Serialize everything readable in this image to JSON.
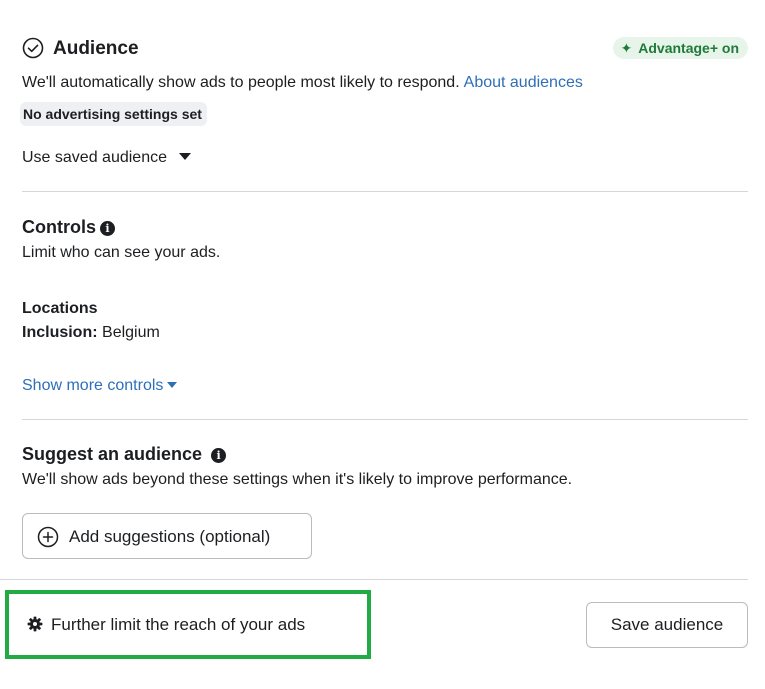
{
  "audience": {
    "title": "Audience",
    "advantage_badge": "Advantage+ on",
    "description": "We'll automatically show ads to people most likely to respond.",
    "about_link": "About audiences",
    "settings_tag": "No advertising settings set",
    "saved_audience_label": "Use saved audience"
  },
  "controls": {
    "title": "Controls",
    "description": "Limit who can see your ads.",
    "locations_heading": "Locations",
    "inclusion_label": "Inclusion:",
    "inclusion_value": "Belgium",
    "show_more": "Show more controls"
  },
  "suggest": {
    "title": "Suggest an audience",
    "description": "We'll show ads beyond these settings when it's likely to improve performance.",
    "add_button": "Add suggestions (optional)"
  },
  "footer": {
    "further_limit": "Further limit the reach of your ads",
    "save_button": "Save audience"
  },
  "colors": {
    "accent_link": "#2e6fb7",
    "advantage_green": "#1f7a3a",
    "highlight_green": "#22aa44"
  },
  "icons": {
    "audience_status": "check-circle-icon",
    "advantage": "sparkle-icon",
    "info": "info-icon",
    "add": "plus-circle-icon",
    "settings": "gear-icon"
  }
}
